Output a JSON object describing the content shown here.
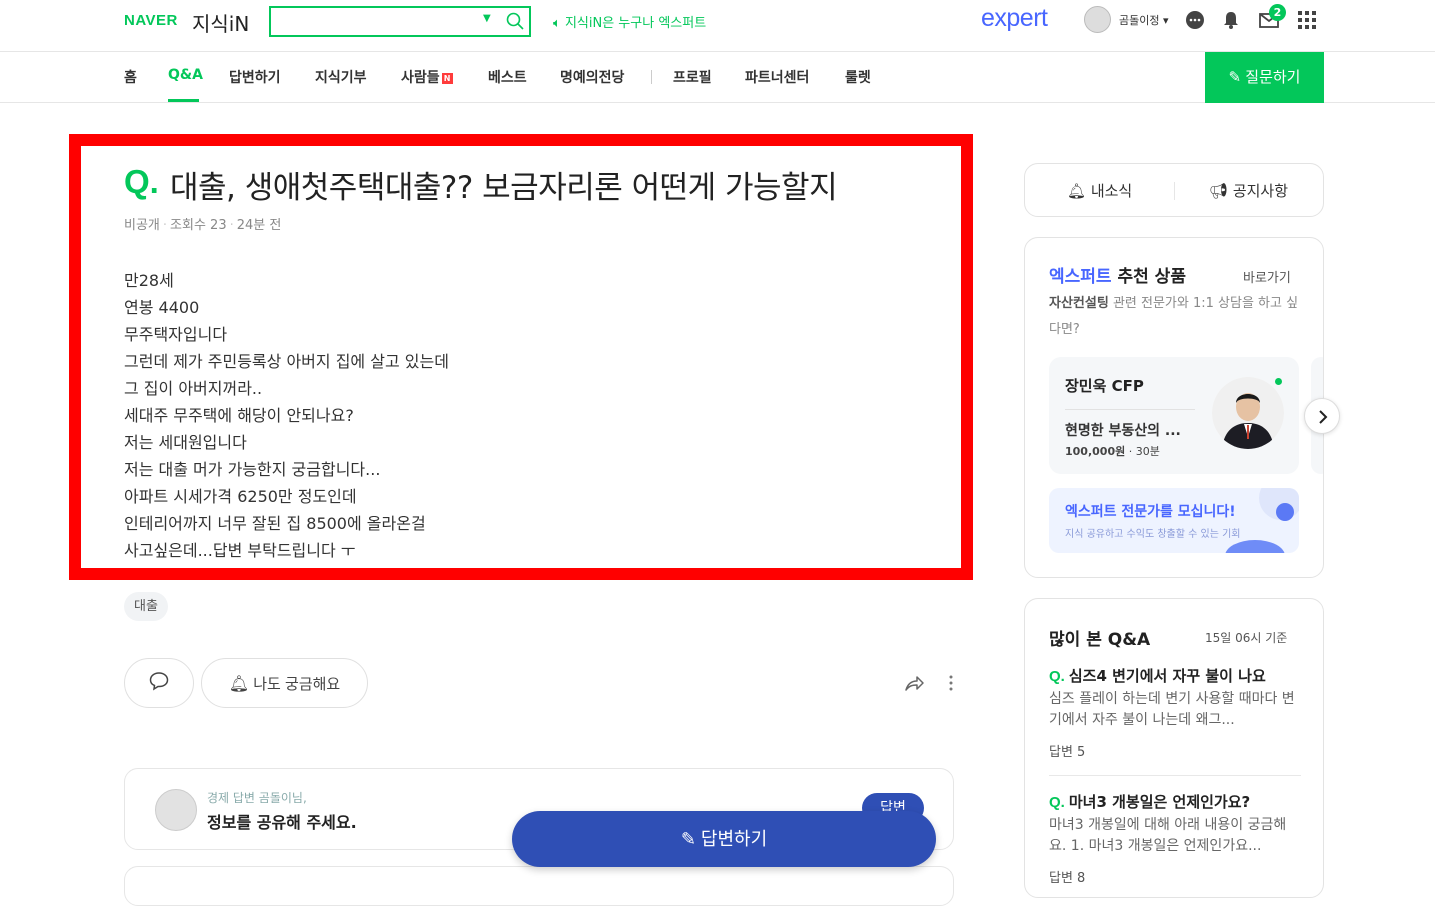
{
  "header": {
    "logo_naver": "NAVER",
    "logo_kin": "지식iN",
    "search_value": "",
    "slogan": "지식iN은 누구나 엑스퍼트",
    "expert_logo": "expert",
    "user_name": "곰돌이정 ▾",
    "mail_badge": "2"
  },
  "nav": {
    "items": [
      "홈",
      "Q&A",
      "답변하기",
      "지식기부",
      "사람들",
      "베스트",
      "명예의전당",
      "프로필",
      "파트너센터",
      "룰렛"
    ],
    "new_badge": "N",
    "ask_button": "질문하기"
  },
  "question": {
    "mark": "Q.",
    "title": "대출, 생애첫주택대출?? 보금자리론 어떤게 가능할지",
    "author": "비공개",
    "views": "조회수 23",
    "time": "24분 전",
    "body": [
      "만28세",
      "연봉 4400",
      "무주택자입니다",
      "그런데 제가 주민등록상 아버지 집에 살고 있는데",
      "그 집이 아버지꺼라..",
      "세대주 무주택에 해당이 안되나요?",
      "저는 세대원입니다",
      "저는 대출 머가 가능한지 궁금합니다...",
      "아파트 시세가격 6250만 정도인데",
      "인테리어까지 너무 잘된 집 8500에 올라온걸",
      "사고싶은데...답변 부탁드립니다 ㅜ"
    ],
    "tag": "대출",
    "curious_label": "나도 궁금해요"
  },
  "answer_prompt": {
    "sub": "경제 답변 곰돌이님,",
    "main": "정보를 공유해 주세요.",
    "small_button": "답변"
  },
  "answer_float_button": "답변하기",
  "sidebar": {
    "tab_news": "내소식",
    "tab_notice": "공지사항",
    "expert_title_blue": "엑스퍼트",
    "expert_title_rest": "추천 상품",
    "expert_go": "바로가기",
    "expert_desc_bold": "자산컨설팅",
    "expert_desc_rest": " 관련 전문가와 1:1 상담을 하고 싶다면?",
    "profile": {
      "name": "장민욱 CFP",
      "topic": "현명한 부동산의 ...",
      "price": "100,000원",
      "duration": "30분"
    },
    "recruit_title": "엑스퍼트 전문가를 모십니다!",
    "recruit_sub": "지식 공유하고 수익도 창출할 수 있는 기회",
    "popular_title": "많이 본 Q&A",
    "popular_date": "15일 06시 기준",
    "popular_items": [
      {
        "q": "심즈4 변기에서 자꾸 불이 나요",
        "body": "심즈 플레이 하는데 변기 사용할 때마다 변기에서 자주 불이 나는데 왜그...",
        "count": "답변 5"
      },
      {
        "q": "마녀3 개봉일은 언제인가요?",
        "body": "마녀3 개봉일에 대해 아래 내용이 궁금해요. 1. 마녀3 개봉일은 언제인가요...",
        "count": "답변 8"
      }
    ]
  }
}
